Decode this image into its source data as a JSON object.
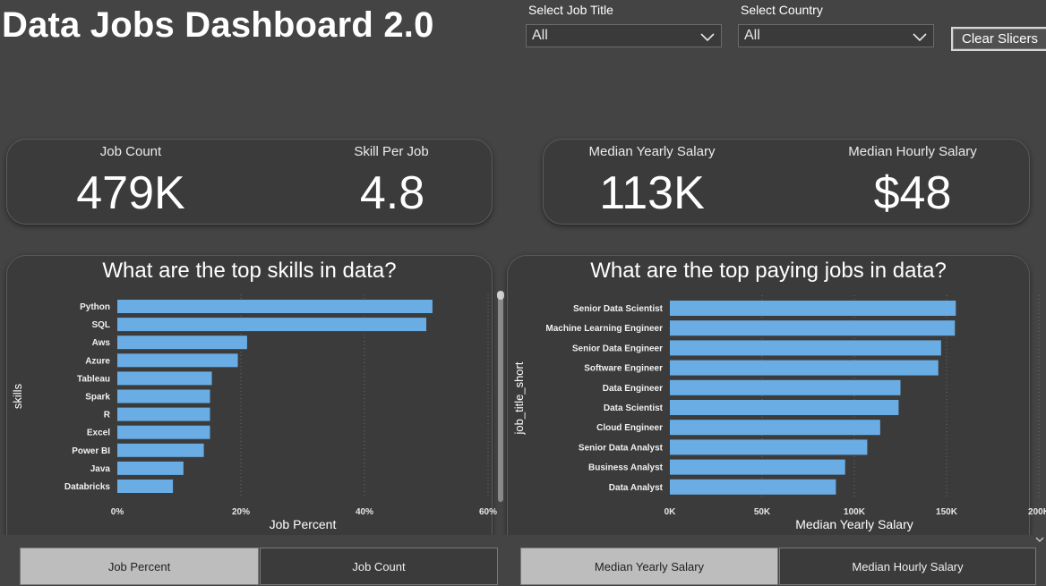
{
  "header": {
    "title": "Data Jobs Dashboard 2.0"
  },
  "slicers": {
    "job_title": {
      "label": "Select Job Title",
      "value": "All"
    },
    "country": {
      "label": "Select Country",
      "value": "All"
    },
    "clear_label": "Clear Slicers"
  },
  "kpis": {
    "job_count": {
      "label": "Job Count",
      "value": "479K"
    },
    "skill_per_job": {
      "label": "Skill Per Job",
      "value": "4.8"
    },
    "median_yearly": {
      "label": "Median Yearly Salary",
      "value": "113K"
    },
    "median_hourly": {
      "label": "Median Hourly Salary",
      "value": "$48"
    }
  },
  "skills_chart": {
    "title": "What are the top skills in data?",
    "bar_color": "#6aade4"
  },
  "jobs_chart": {
    "title": "What are the top paying jobs in data?",
    "bar_color": "#6aade4"
  },
  "tabs_left": {
    "job_percent": "Job Percent",
    "job_count": "Job Count"
  },
  "tabs_right": {
    "median_yearly": "Median Yearly Salary",
    "median_hourly": "Median Hourly Salary"
  },
  "chart_data": [
    {
      "type": "bar",
      "orientation": "horizontal",
      "categories": [
        "Python",
        "SQL",
        "Aws",
        "Azure",
        "Tableau",
        "Spark",
        "R",
        "Excel",
        "Power BI",
        "Java",
        "Databricks"
      ],
      "values": [
        51,
        50,
        21,
        19.5,
        15.3,
        15,
        15,
        15,
        14,
        10.7,
        9
      ],
      "xlabel": "Job Percent",
      "ylabel": "skills",
      "xlim": [
        0,
        60
      ],
      "xticks": [
        "0%",
        "20%",
        "40%",
        "60%"
      ],
      "grid": true
    },
    {
      "type": "bar",
      "orientation": "horizontal",
      "categories": [
        "Senior Data Scientist",
        "Machine Learning Engineer",
        "Senior Data Engineer",
        "Software Engineer",
        "Data Engineer",
        "Data Scientist",
        "Cloud Engineer",
        "Senior Data Analyst",
        "Business Analyst",
        "Data Analyst"
      ],
      "values": [
        155000,
        154500,
        147000,
        145500,
        125000,
        124000,
        114000,
        107000,
        95000,
        90000
      ],
      "xlabel": "Median Yearly Salary",
      "ylabel": "job_title_short",
      "xlim": [
        0,
        200000
      ],
      "xticks": [
        "0K",
        "50K",
        "100K",
        "150K",
        "200K"
      ],
      "grid": true
    }
  ]
}
